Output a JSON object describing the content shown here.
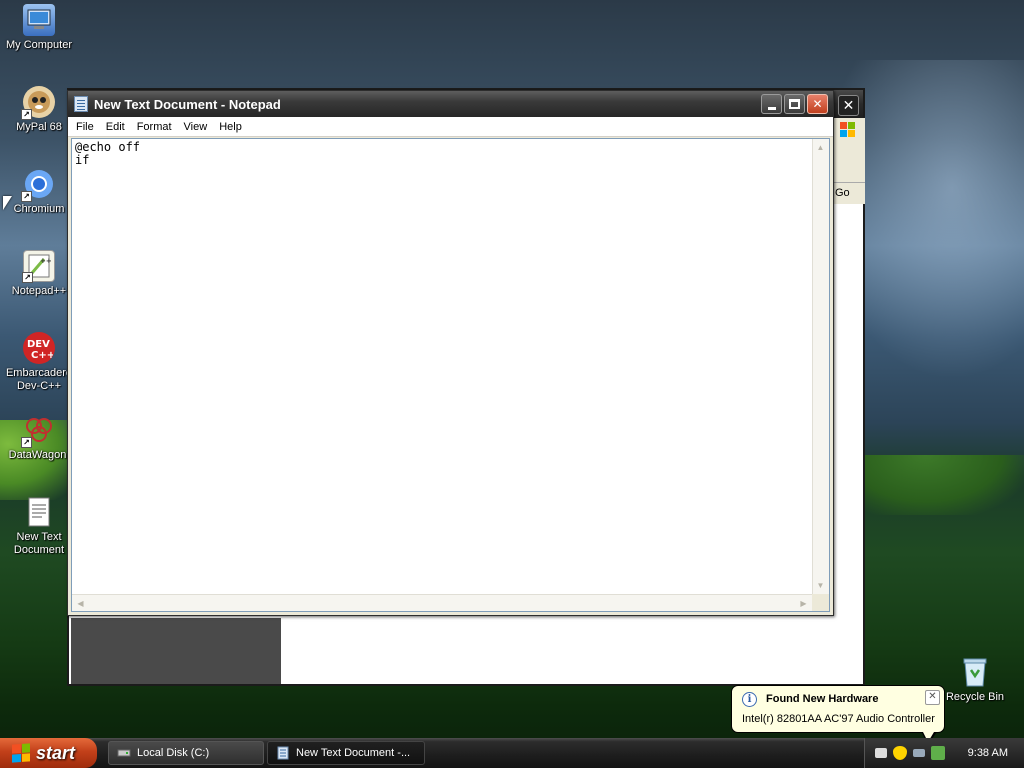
{
  "desktop": {
    "icons": [
      {
        "label": "My Computer",
        "glyph": "computer-icon",
        "color": "#5a8fd8"
      },
      {
        "label": "MyPal 68",
        "glyph": "mypal-icon",
        "color": "#d9b777"
      },
      {
        "label": "Chromium",
        "glyph": "chromium-icon",
        "color": "#4d90fe"
      },
      {
        "label": "Notepad++",
        "glyph": "notepadpp-icon",
        "color": "#7cbb46"
      },
      {
        "label": "Embarcadero Dev-C++",
        "glyph": "devcpp-icon",
        "color": "#d02525"
      },
      {
        "label": "DataWagon.",
        "glyph": "datawagon-icon",
        "color": "#c03030"
      },
      {
        "label": "New Text Document",
        "glyph": "text-document-icon",
        "color": "#f4f4f4"
      }
    ],
    "recycle_bin": {
      "label": "Recycle Bin",
      "glyph": "recycle-bin-icon"
    }
  },
  "background_window": {
    "go_label": "Go",
    "close_glyph": "✕"
  },
  "notepad": {
    "title": "New Text Document - Notepad",
    "menu": [
      "File",
      "Edit",
      "Format",
      "View",
      "Help"
    ],
    "content": "@echo off\nif",
    "controls": {
      "minimize": "minimize",
      "maximize": "maximize",
      "close": "✕"
    }
  },
  "taskbar": {
    "start_label": "start",
    "buttons": [
      {
        "label": "Local Disk (C:)",
        "icon": "drive-icon"
      },
      {
        "label": "New Text Document -...",
        "icon": "notepad-icon"
      }
    ],
    "clock": "9:38 AM"
  },
  "balloon": {
    "title": "Found New Hardware",
    "text": "Intel(r) 82801AA AC'97 Audio Controller",
    "info_glyph": "i",
    "close_glyph": "✕"
  }
}
